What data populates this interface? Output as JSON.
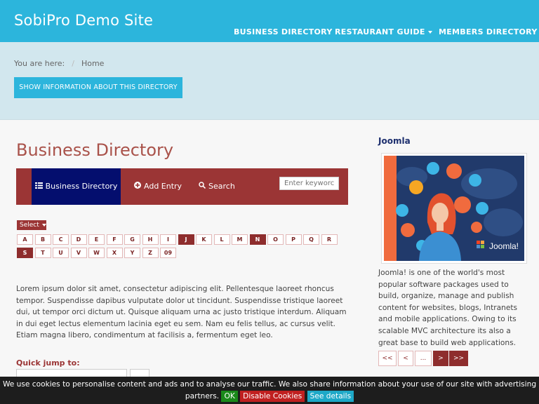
{
  "header": {
    "site_title": "SobiPro Demo Site",
    "nav": [
      {
        "label": "BUSINESS DIRECTORY"
      },
      {
        "label": "RESTAURANT GUIDE"
      },
      {
        "label": "MEMBERS DIRECTORY"
      }
    ]
  },
  "breadcrumb": {
    "prefix": "You are here:",
    "separator": "/",
    "current": "Home"
  },
  "info_button": "SHOW INFORMATION ABOUT THIS DIRECTORY",
  "main": {
    "title": "Business Directory",
    "menu": {
      "directory": "Business Directory",
      "add_entry": "Add Entry",
      "search": "Search",
      "search_placeholder": "Enter keyworc"
    },
    "select_label": "Select",
    "alpha_row1": [
      "A",
      "B",
      "C",
      "D",
      "E",
      "F",
      "G",
      "H",
      "I",
      "J",
      "K",
      "L",
      "M",
      "N",
      "O",
      "P",
      "Q",
      "R"
    ],
    "alpha_row2": [
      "S",
      "T",
      "U",
      "V",
      "W",
      "X",
      "Y",
      "Z",
      "09"
    ],
    "alpha_active": [
      "J",
      "N",
      "S"
    ],
    "description": "Lorem ipsum dolor sit amet, consectetur adipiscing elit. Pellentesque laoreet rhoncus tempor. Suspendisse dapibus vulputate dolor ut tincidunt. Suspendisse tristique laoreet dui, ut tempor orci dictum ut. Quisque aliquam urna ac justo tristique interdum. Aliquam in dui eget lectus elementum lacinia eget eu sem. Nam eu felis tellus, ac cursus velit. Etiam magna libero, condimentum at facilisis a, fermentum eget leo.",
    "quick_jump_label": "Quick jump to:"
  },
  "sidebar": {
    "title": "Joomla",
    "image_logo_text": "Joomla!",
    "text": "Joomla! is one of the world's most popular software packages used to build, organize, manage and publish content for websites, blogs, Intranets and mobile applications. Owing to its scalable MVC architecture its also a great base to build web applications.",
    "pager": [
      "<<",
      "<",
      "...",
      ">",
      ">>"
    ]
  },
  "cookie": {
    "text": "We use cookies to personalise content and ads and to analyse our traffic. We also share information about your use of our site with advertising partners.",
    "ok": "OK",
    "disable": "Disable Cookies",
    "details": "See details"
  },
  "colors": {
    "header": "#2cb5dc",
    "hero": "#d2e7ee",
    "menubar": "#9b3535",
    "menu_active": "#040e6e",
    "title": "#a9524a"
  }
}
